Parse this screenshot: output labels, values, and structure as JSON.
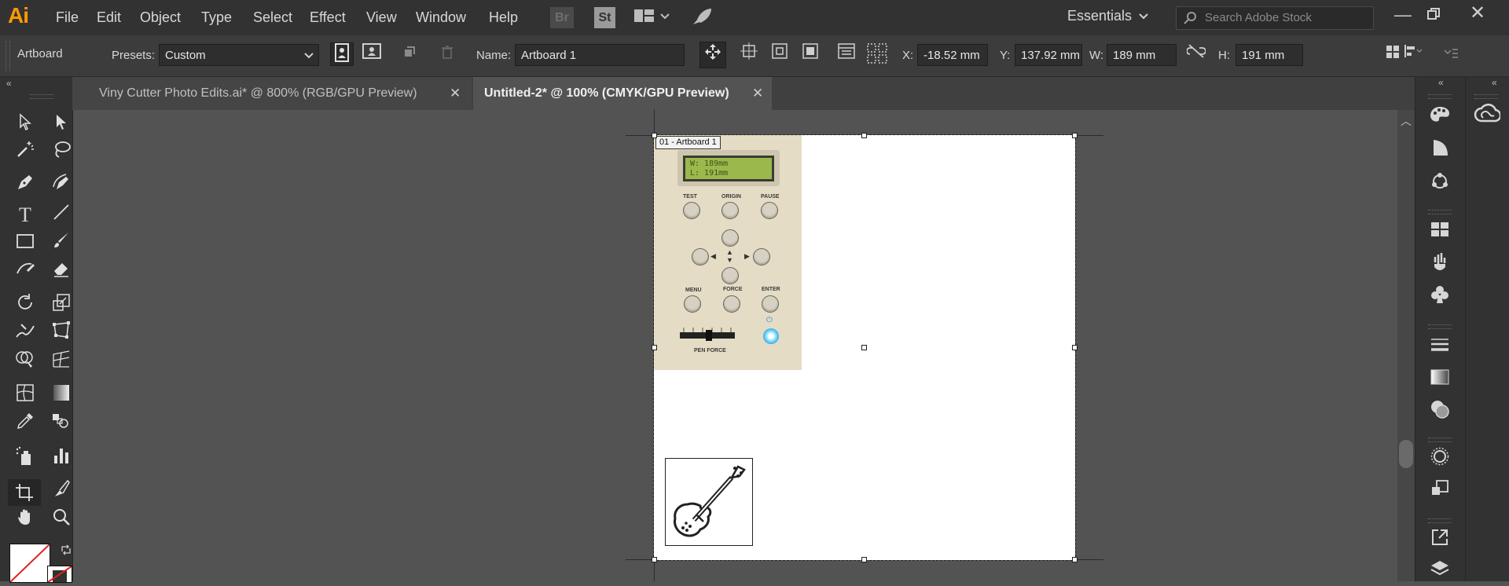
{
  "app": {
    "logo": "Ai",
    "menus": [
      "File",
      "Edit",
      "Object",
      "Type",
      "Select",
      "Effect",
      "View",
      "Window",
      "Help"
    ],
    "bridge_label": "Br",
    "stock_label": "St",
    "workspace": "Essentials",
    "search_placeholder": "Search Adobe Stock"
  },
  "control": {
    "tool_name": "Artboard",
    "presets_label": "Presets:",
    "presets_value": "Custom",
    "name_label": "Name:",
    "name_value": "Artboard 1",
    "x_label": "X:",
    "x_value": "-18.52 mm",
    "y_label": "Y:",
    "y_value": "137.92 mm",
    "w_label": "W:",
    "w_value": "189 mm",
    "h_label": "H:",
    "h_value": "191 mm"
  },
  "tabs": [
    {
      "label": "Viny Cutter Photo Edits.ai* @ 800% (RGB/GPU Preview)",
      "active": false
    },
    {
      "label": "Untitled-2* @ 100% (CMYK/GPU Preview)",
      "active": true
    }
  ],
  "canvas": {
    "artboard_label": "01 - Artboard 1",
    "photo": {
      "lcd_line1": "W: 189mm",
      "lcd_line2": "L: 191mm",
      "btn_test": "TEST",
      "btn_origin": "ORIGIN",
      "btn_pause": "PAUSE",
      "btn_menu": "MENU",
      "btn_force": "FORCE",
      "btn_enter": "ENTER",
      "pen_force": "PEN FORCE"
    }
  },
  "colors": {
    "accent": "#ff9a00",
    "menubar_bg": "#323232",
    "canvas_bg": "#535353"
  }
}
